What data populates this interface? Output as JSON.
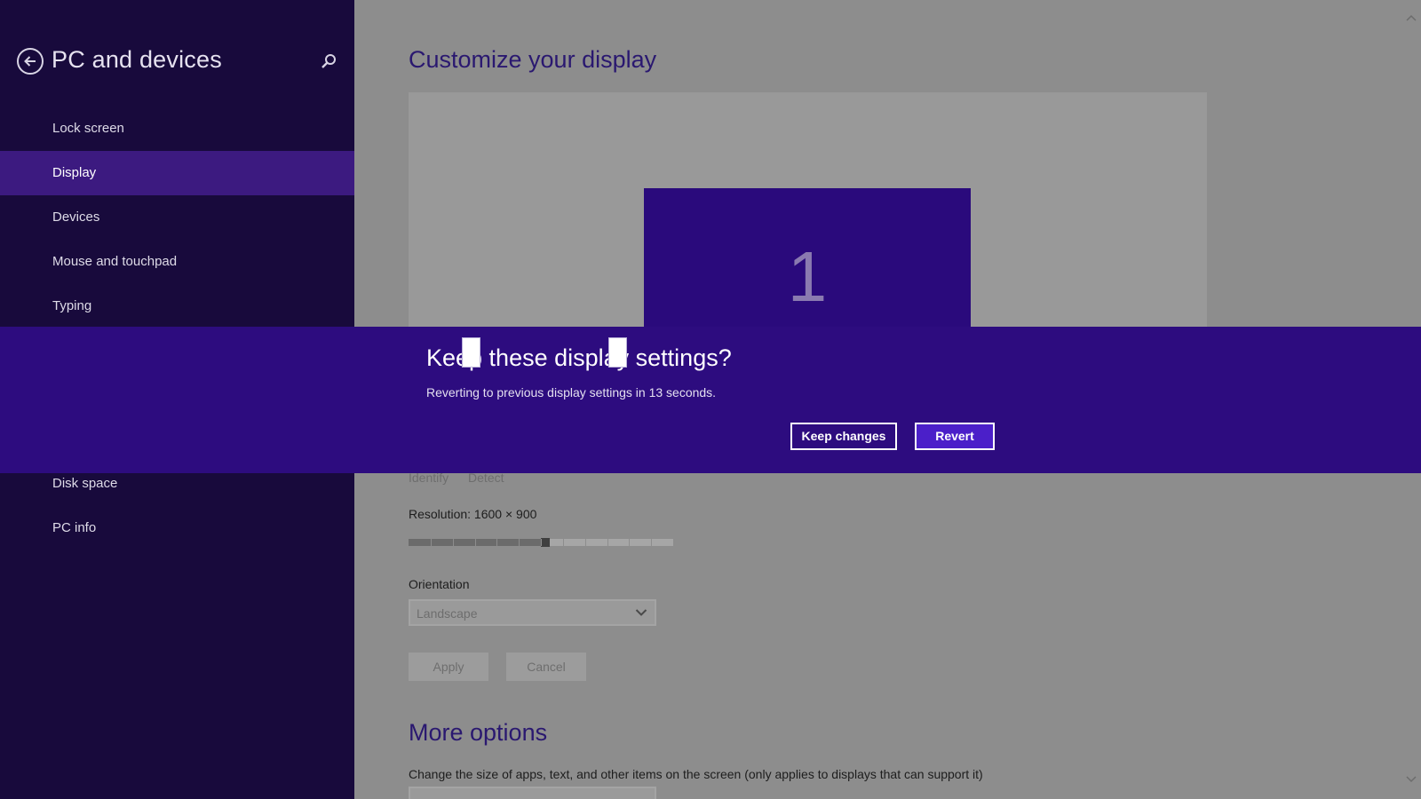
{
  "sidebar": {
    "title": "PC and devices",
    "back_icon": "back-arrow-icon",
    "search_icon": "search-icon",
    "items_top": [
      {
        "label": "Lock screen",
        "active": false
      },
      {
        "label": "Display",
        "active": true
      },
      {
        "label": "Devices",
        "active": false
      },
      {
        "label": "Mouse and touchpad",
        "active": false
      },
      {
        "label": "Typing",
        "active": false
      }
    ],
    "items_bottom": [
      {
        "label": "Disk space",
        "active": false
      },
      {
        "label": "PC info",
        "active": false
      }
    ]
  },
  "main": {
    "title": "Customize your display",
    "monitor_number": "1",
    "identify_label": "Identify",
    "detect_label": "Detect",
    "resolution_label": "Resolution: 1600 × 900",
    "resolution_slider": {
      "steps": 12,
      "selected_step": 6
    },
    "orientation_label": "Orientation",
    "orientation_value": "Landscape",
    "apply_label": "Apply",
    "cancel_label": "Cancel",
    "more_options_title": "More options",
    "more_options_desc": "Change the size of apps, text, and other items on the screen (only applies to displays that can support it)"
  },
  "dialog": {
    "title": "Keep these display settings?",
    "message": "Reverting to previous display settings in 13 seconds.",
    "keep_label": "Keep changes",
    "revert_label": "Revert"
  },
  "colors": {
    "sidebar_bg": "#180a3c",
    "sidebar_active": "#3c1a80",
    "banner_bg": "#2d0c7f",
    "revert_bg": "#4b1fc9",
    "main_bg_dimmed": "#8d8d8d"
  }
}
